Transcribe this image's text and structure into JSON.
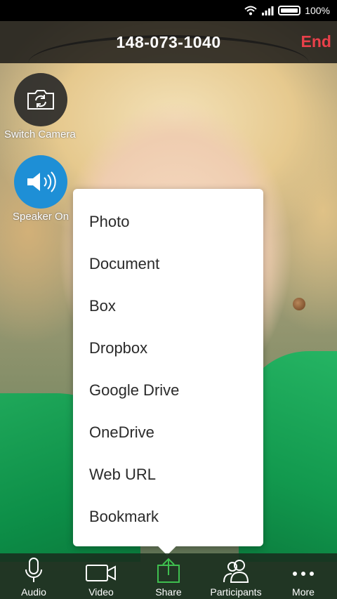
{
  "status": {
    "battery": "100%"
  },
  "call": {
    "meeting_id": "148-073-1040",
    "end_label": "End"
  },
  "side": {
    "switch_camera_label": "Switch Camera",
    "speaker_label": "Speaker On"
  },
  "share_menu": {
    "items": [
      "Photo",
      "Document",
      "Box",
      "Dropbox",
      "Google Drive",
      "OneDrive",
      "Web URL",
      "Bookmark"
    ]
  },
  "toolbar": {
    "audio": "Audio",
    "video": "Video",
    "share": "Share",
    "participants": "Participants",
    "more": "More"
  },
  "colors": {
    "end": "#e8404a",
    "share_active": "#3fbf4f",
    "speaker": "#1e8fd6"
  }
}
